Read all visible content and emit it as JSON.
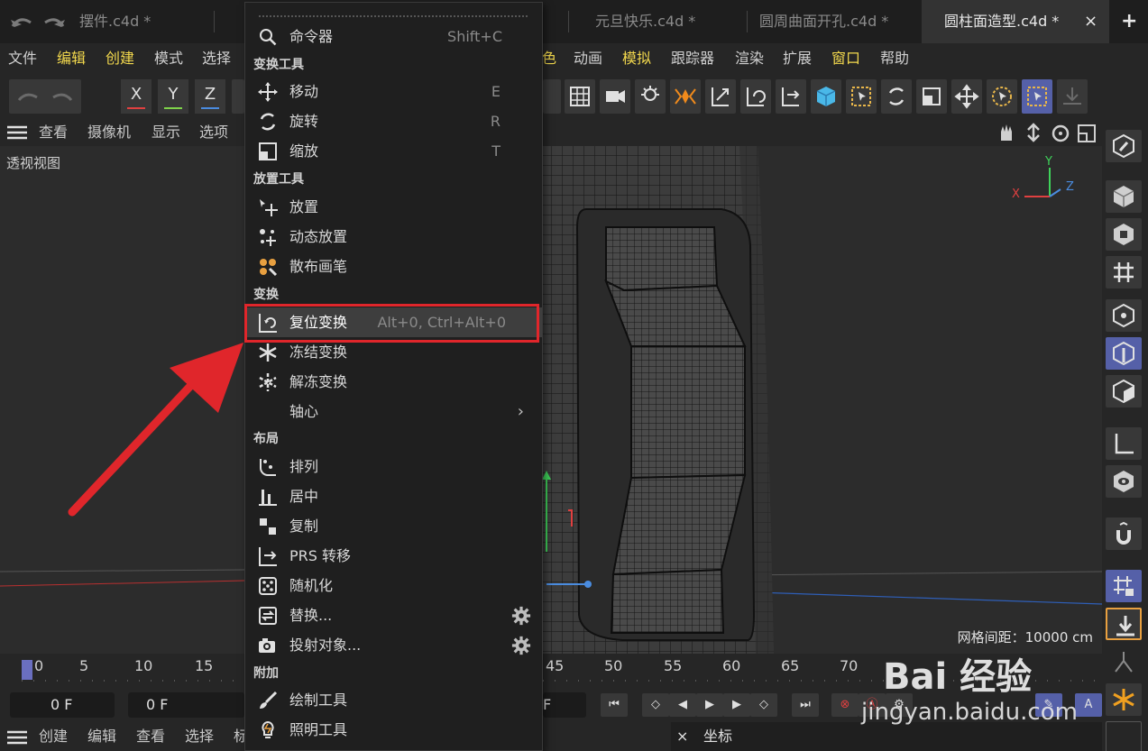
{
  "tabs": {
    "items": [
      {
        "label": "摆件.c4d *"
      },
      {
        "label": "元旦快乐.c4d *"
      },
      {
        "label": "圆周曲面开孔.c4d *"
      },
      {
        "label": "圆柱面造型.c4d *",
        "active": true
      }
    ],
    "close_glyph": "×",
    "add_glyph": "+"
  },
  "menubar": {
    "items": [
      "文件",
      "编辑",
      "创建",
      "模式",
      "选择",
      "色",
      "动画",
      "模拟",
      "跟踪器",
      "渲染",
      "扩展",
      "窗口",
      "帮助"
    ],
    "highlighted": [
      "编辑",
      "创建",
      "模拟",
      "窗口"
    ]
  },
  "toolbar": {
    "axis_x": "X",
    "axis_y": "Y",
    "axis_z": "Z",
    "axis_colors": {
      "x": "#e04040",
      "y": "#7fd34a",
      "z": "#4a8ce0"
    }
  },
  "viewport": {
    "menu": [
      "查看",
      "摄像机",
      "显示",
      "选项"
    ],
    "label": "透视视图",
    "grid_spacing": "网格间距：10000 cm",
    "axis_labels": {
      "x": "X",
      "y": "Y",
      "z": "Z"
    }
  },
  "timeline": {
    "ticks_left": [
      "0",
      "5",
      "10",
      "15"
    ],
    "ticks_right": [
      "45",
      "50",
      "55",
      "60",
      "65",
      "70"
    ],
    "current_frame": "0 F",
    "start_frame": "0 F",
    "end_frame": "F"
  },
  "bottombar": {
    "items": [
      "创建",
      "编辑",
      "查看",
      "选择",
      "标"
    ],
    "coord_panel_title": "坐标",
    "coord_close": "×"
  },
  "context_menu": {
    "command": {
      "label": "命令器",
      "shortcut": "Shift+C"
    },
    "sections": [
      {
        "title": "变换工具",
        "items": [
          {
            "label": "移动",
            "shortcut": "E",
            "icon": "move-icon"
          },
          {
            "label": "旋转",
            "shortcut": "R",
            "icon": "rotate-icon"
          },
          {
            "label": "缩放",
            "shortcut": "T",
            "icon": "scale-icon"
          }
        ]
      },
      {
        "title": "放置工具",
        "items": [
          {
            "label": "放置",
            "icon": "place-icon"
          },
          {
            "label": "动态放置",
            "icon": "dynamic-place-icon"
          },
          {
            "label": "散布画笔",
            "icon": "scatter-brush-icon"
          }
        ]
      },
      {
        "title": "变换",
        "items": [
          {
            "label": "复位变换",
            "shortcut": "Alt+0, Ctrl+Alt+0",
            "icon": "reset-transform-icon",
            "active": true
          },
          {
            "label": "冻结变换",
            "icon": "freeze-icon"
          },
          {
            "label": "解冻变换",
            "icon": "unfreeze-icon"
          },
          {
            "label": "轴心",
            "icon": "",
            "submenu": "›"
          }
        ]
      },
      {
        "title": "布局",
        "items": [
          {
            "label": "排列",
            "icon": "arrange-icon"
          },
          {
            "label": "居中",
            "icon": "center-icon"
          },
          {
            "label": "复制",
            "icon": "duplicate-icon"
          },
          {
            "label": "PRS 转移",
            "icon": "prs-transfer-icon"
          },
          {
            "label": "随机化",
            "icon": "randomize-icon"
          },
          {
            "label": "替换...",
            "icon": "replace-icon",
            "gear": true
          },
          {
            "label": "投射对象...",
            "icon": "project-icon",
            "gear": true
          }
        ]
      },
      {
        "title": "附加",
        "items": [
          {
            "label": "绘制工具",
            "icon": "paint-tool-icon"
          },
          {
            "label": "照明工具",
            "icon": "lighting-tool-icon"
          }
        ]
      }
    ]
  },
  "colors": {
    "highlight_border": "#e0262b",
    "menu_accent": "#f2d84d",
    "selected_button": "#5560a8"
  },
  "watermark": {
    "text": "Bai 经验",
    "url": "jingyan.baidu.com"
  }
}
